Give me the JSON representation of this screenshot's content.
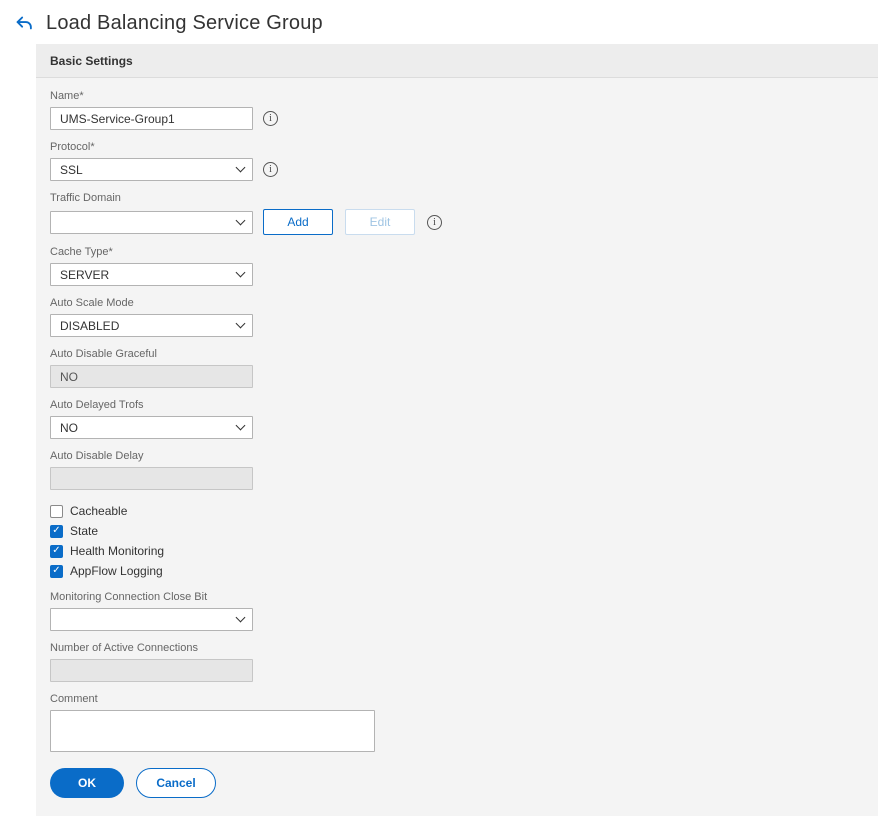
{
  "colors": {
    "accent": "#0a6cc8",
    "panel-bg": "#f4f4f4",
    "panel-header-bg": "#ededed",
    "input-border": "#b3b3b3",
    "disabled-bg": "#e6e6e6"
  },
  "page": {
    "title": "Load Balancing Service Group"
  },
  "panel": {
    "header": "Basic Settings"
  },
  "fields": {
    "name": {
      "label": "Name*",
      "value": "UMS-Service-Group1"
    },
    "protocol": {
      "label": "Protocol*",
      "value": "SSL"
    },
    "traffic_domain": {
      "label": "Traffic Domain",
      "value": ""
    },
    "cache_type": {
      "label": "Cache Type*",
      "value": "SERVER"
    },
    "auto_scale_mode": {
      "label": "Auto Scale Mode",
      "value": "DISABLED"
    },
    "auto_disable_graceful": {
      "label": "Auto Disable Graceful",
      "value": "NO"
    },
    "auto_delayed_trofs": {
      "label": "Auto Delayed Trofs",
      "value": "NO"
    },
    "auto_disable_delay": {
      "label": "Auto Disable Delay",
      "value": ""
    },
    "monitoring_connection_close_bit": {
      "label": "Monitoring Connection Close Bit",
      "value": ""
    },
    "number_of_active_connections": {
      "label": "Number of Active Connections",
      "value": ""
    },
    "comment": {
      "label": "Comment",
      "value": ""
    }
  },
  "checkboxes": [
    {
      "label": "Cacheable",
      "checked": false
    },
    {
      "label": "State",
      "checked": true
    },
    {
      "label": "Health Monitoring",
      "checked": true
    },
    {
      "label": "AppFlow Logging",
      "checked": true
    }
  ],
  "buttons": {
    "add": "Add",
    "edit": "Edit",
    "ok": "OK",
    "cancel": "Cancel"
  }
}
